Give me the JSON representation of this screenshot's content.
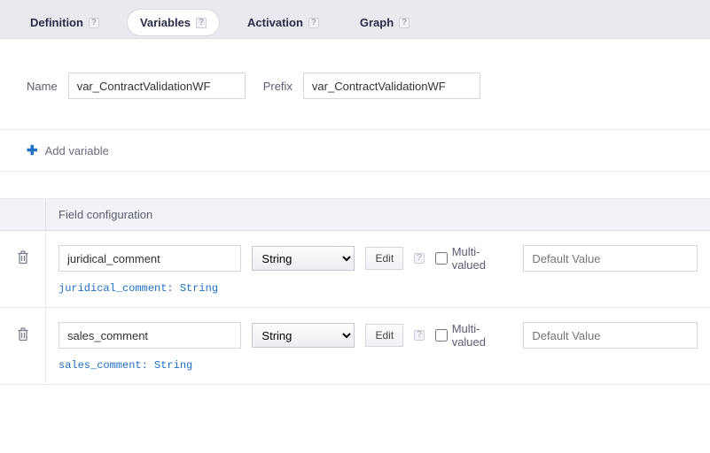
{
  "tabs": {
    "definition": "Definition",
    "variables": "Variables",
    "activation": "Activation",
    "graph": "Graph"
  },
  "help_glyph": "?",
  "form": {
    "name_label": "Name",
    "name_value": "var_ContractValidationWF",
    "prefix_label": "Prefix",
    "prefix_value": "var_ContractValidationWF"
  },
  "add_variable_label": "Add variable",
  "config_header": "Field configuration",
  "edit_label": "Edit",
  "multi_valued_label": "Multi-valued",
  "default_placeholder": "Default Value",
  "type_option": "String",
  "variables": [
    {
      "name": "juridical_comment",
      "desc": "juridical_comment: String"
    },
    {
      "name": "sales_comment",
      "desc": "sales_comment: String"
    }
  ]
}
